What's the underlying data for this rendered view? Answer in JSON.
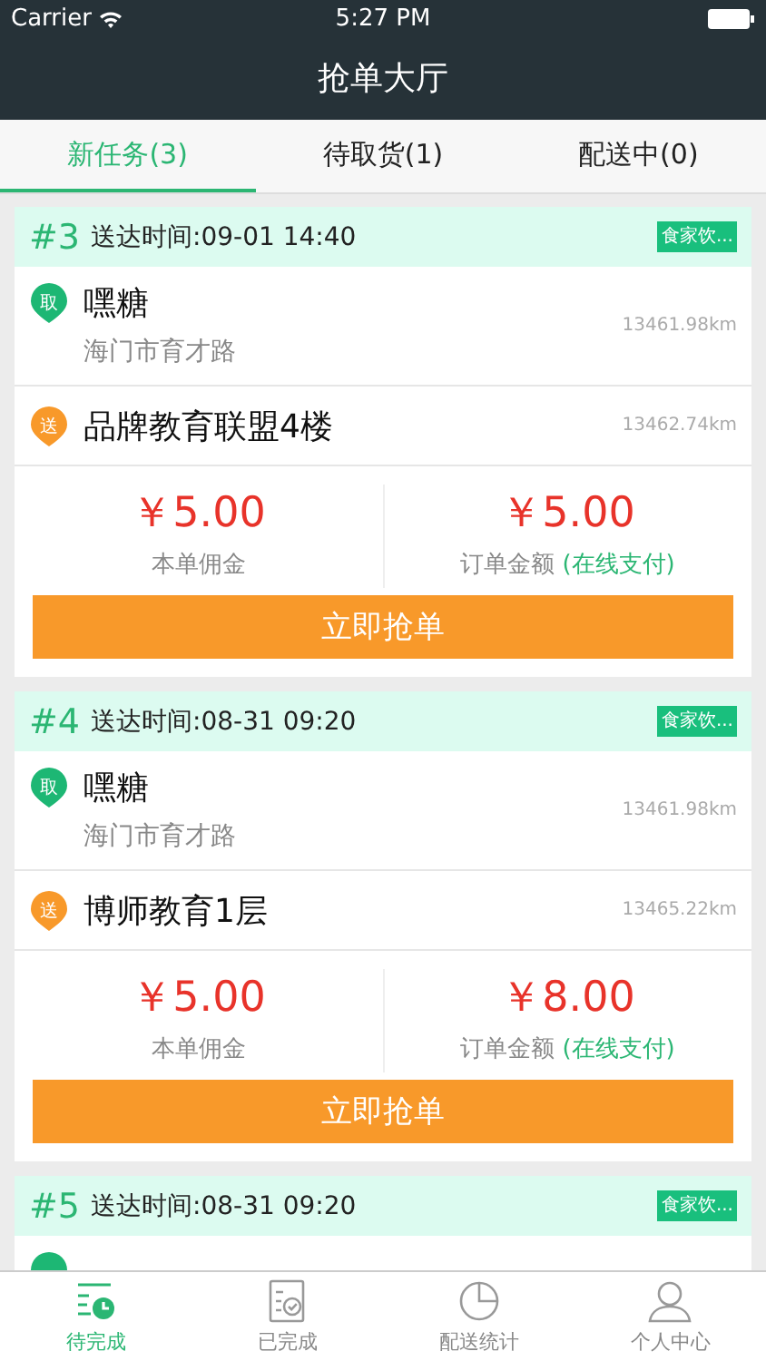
{
  "status_bar": {
    "carrier": "Carrier",
    "time": "5:27 PM"
  },
  "nav": {
    "title": "抢单大厅"
  },
  "tabs": [
    {
      "label": "新任务(3)",
      "selected": true
    },
    {
      "label": "待取货(1)",
      "selected": false
    },
    {
      "label": "配送中(0)",
      "selected": false
    }
  ],
  "orders": [
    {
      "number": "#3",
      "delivery_time": "送达时间:09-01 14:40",
      "tag": "食家饮...",
      "stops": [
        {
          "kind": "pickup",
          "badge": "取",
          "name": "嘿糖",
          "address": "海门市育才路",
          "distance": "13461.98km"
        },
        {
          "kind": "dropoff",
          "badge": "送",
          "name": "品牌教育联盟4楼",
          "distance": "13462.74km"
        }
      ],
      "commission": {
        "amount": "￥5.00",
        "label": "本单佣金"
      },
      "order_amount": {
        "amount": "￥5.00",
        "label": "订单金额",
        "payment": "(在线支付)"
      },
      "button": "立即抢单"
    },
    {
      "number": "#4",
      "delivery_time": "送达时间:08-31 09:20",
      "tag": "食家饮...",
      "stops": [
        {
          "kind": "pickup",
          "badge": "取",
          "name": "嘿糖",
          "address": "海门市育才路",
          "distance": "13461.98km"
        },
        {
          "kind": "dropoff",
          "badge": "送",
          "name": "博师教育1层",
          "distance": "13465.22km"
        }
      ],
      "commission": {
        "amount": "￥5.00",
        "label": "本单佣金"
      },
      "order_amount": {
        "amount": "￥8.00",
        "label": "订单金额",
        "payment": "(在线支付)"
      },
      "button": "立即抢单"
    },
    {
      "number": "#5",
      "delivery_time": "送达时间:08-31 09:20",
      "tag": "食家饮...",
      "stops": [
        {
          "kind": "pickup"
        }
      ]
    }
  ],
  "tab_bar": [
    {
      "kind": "pending",
      "label": "待完成",
      "selected": true
    },
    {
      "kind": "done",
      "label": "已完成",
      "selected": false
    },
    {
      "kind": "stats",
      "label": "配送统计",
      "selected": false
    },
    {
      "kind": "profile",
      "label": "个人中心",
      "selected": false
    }
  ]
}
